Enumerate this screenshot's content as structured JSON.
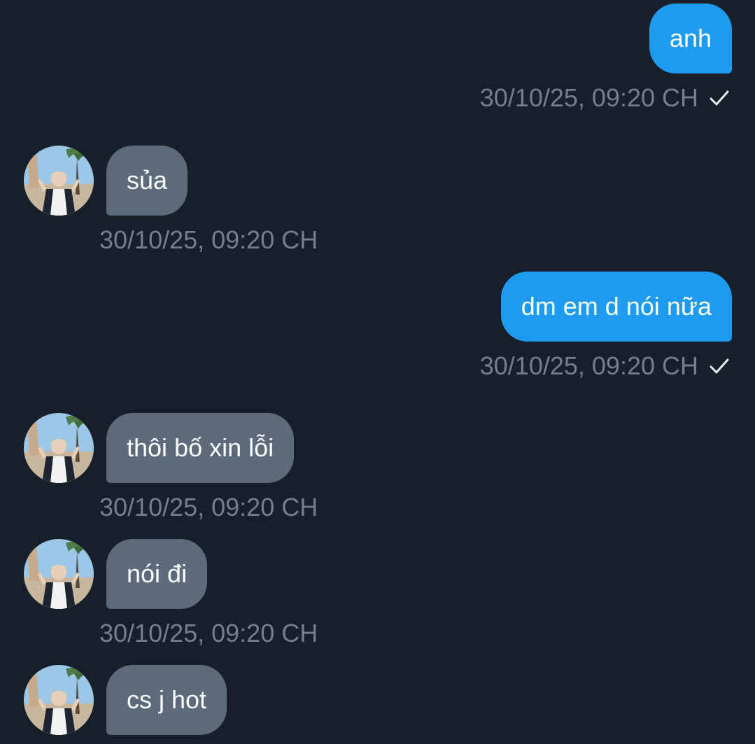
{
  "conversation": {
    "messages": [
      {
        "direction": "outgoing",
        "text": "anh",
        "time": "30/10/25, 09:20 CH",
        "status": "check-icon"
      },
      {
        "direction": "incoming",
        "text": "sủa",
        "time": "30/10/25, 09:20 CH",
        "avatar": "avatar-photo"
      },
      {
        "direction": "outgoing",
        "text": "dm em d nói nữa",
        "time": "30/10/25, 09:20 CH",
        "status": "check-icon"
      },
      {
        "direction": "incoming",
        "text": "thôi bố xin lỗi",
        "time": "30/10/25, 09:20 CH",
        "avatar": "avatar-photo"
      },
      {
        "direction": "incoming",
        "text": "nói đi",
        "time": "30/10/25, 09:20 CH",
        "avatar": "avatar-photo"
      },
      {
        "direction": "incoming",
        "text": "cs j hot",
        "avatar": "avatar-photo"
      }
    ]
  },
  "colors": {
    "background": "#17202a",
    "outgoing_bubble": "#1d9bf0",
    "incoming_bubble": "#5b6b7c",
    "timestamp": "#72808e"
  }
}
